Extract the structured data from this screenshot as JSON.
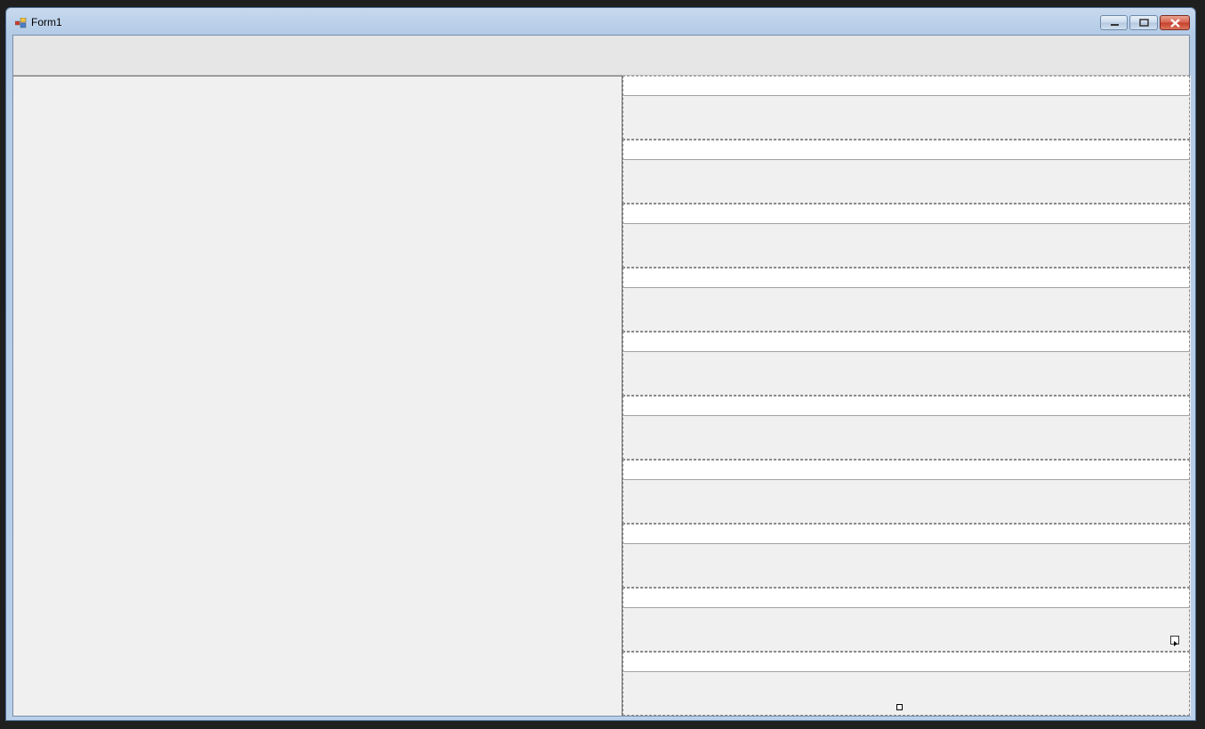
{
  "window": {
    "title": "Form1",
    "icon": "form-app-icon",
    "controls": [
      "minimize-icon",
      "restore-icon",
      "close-icon"
    ]
  },
  "toolstrip": {
    "items": []
  },
  "right_panel": {
    "rows": [
      {
        "input_value": "",
        "area_text": ""
      },
      {
        "input_value": "",
        "area_text": ""
      },
      {
        "input_value": "",
        "area_text": ""
      },
      {
        "input_value": "",
        "area_text": ""
      },
      {
        "input_value": "",
        "area_text": ""
      },
      {
        "input_value": "",
        "area_text": ""
      },
      {
        "input_value": "",
        "area_text": ""
      },
      {
        "input_value": "",
        "area_text": ""
      },
      {
        "input_value": "",
        "area_text": ""
      },
      {
        "input_value": "",
        "area_text": ""
      }
    ]
  },
  "colors": {
    "title_bar": "#b9d0ea",
    "client_background": "#f0f0f0",
    "toolstrip_background": "#e6e6e6",
    "close_button": "#c63f2c"
  }
}
